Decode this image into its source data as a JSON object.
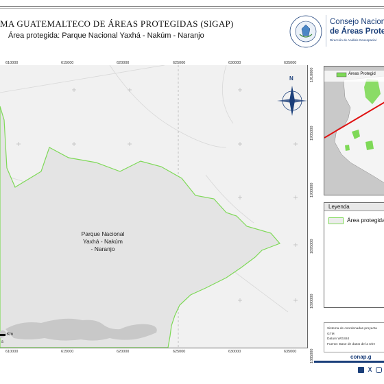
{
  "header": {
    "title": "MA GUATEMALTECO DE ÁREAS PROTEGIDAS  (SIGAP)",
    "subtitle": "Área protegida: Parque Nacional Yaxhá - Nakúm - Naranjo",
    "org_line1": "Consejo Nacional",
    "org_line2": "de Áreas Protegi",
    "org_line3": "Dirección de Análisis Geoespacial",
    "seal_text_top": "GOBIERNO DE LA REPÚBLICA",
    "seal_text_bottom": "GUATEMALA"
  },
  "map": {
    "x_ticks": [
      "610000",
      "615000",
      "620000",
      "625000",
      "630000",
      "635000"
    ],
    "y_ticks": [
      "1910000",
      "1905000",
      "1900000",
      "1895000",
      "1890000",
      "1885000"
    ],
    "area_label": [
      "Parque Nacional",
      "Yaxhá - Nakúm",
      "- Naranjo"
    ],
    "north_letter": "N",
    "scale_unit": "Km",
    "scale_fragment": "s",
    "colors": {
      "background": "#f1f1f1",
      "area_fill": "#e4e4e4",
      "boundary": "#7ed957",
      "lake": "#c8c8c8",
      "roads": "#d8d8d8"
    }
  },
  "inset": {
    "legend_label": "Áreas Protegid",
    "colors": {
      "sea": "#c9c9c9",
      "land": "#f4f4f4",
      "protected": "#7ed957",
      "pointer": "#e01010"
    }
  },
  "legend": {
    "title": "Leyenda",
    "item_label": "Área protegida"
  },
  "metadata": {
    "lines": [
      "Sistema de coordenadas proyecta",
      "GTM",
      "Datum WGS84",
      "Fuente: Base de datos de la Dire"
    ]
  },
  "footer": {
    "url": "conap.g",
    "social_icons": [
      "facebook-icon",
      "x-icon",
      "youtube-icon",
      "instagram-icon"
    ]
  }
}
